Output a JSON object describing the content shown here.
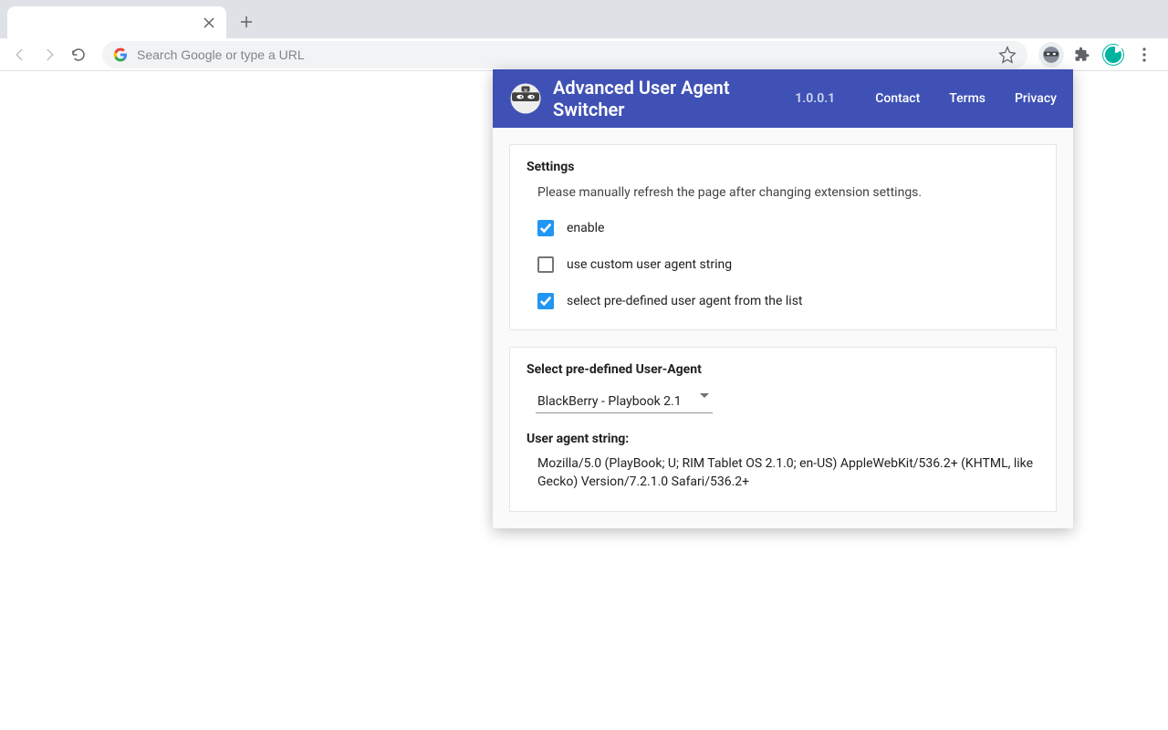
{
  "browser": {
    "omnibox_placeholder": "Search Google or type a URL"
  },
  "popup": {
    "title": "Advanced User Agent Switcher",
    "version": "1.0.0.1",
    "links": {
      "contact": "Contact",
      "terms": "Terms",
      "privacy": "Privacy"
    },
    "settings": {
      "heading": "Settings",
      "note": "Please manually refresh the page after changing extension settings.",
      "items": [
        {
          "label": "enable",
          "checked": true
        },
        {
          "label": "use custom user agent string",
          "checked": false
        },
        {
          "label": "select pre-defined user agent from the list",
          "checked": true
        }
      ]
    },
    "predefined": {
      "heading": "Select pre-defined User-Agent",
      "selected": "BlackBerry - Playbook 2.1",
      "ua_label": "User agent string:",
      "ua_value": "Mozilla/5.0 (PlayBook; U; RIM Tablet OS 2.1.0; en-US) AppleWebKit/536.2+ (KHTML, like Gecko) Version/7.2.1.0 Safari/536.2+"
    }
  }
}
